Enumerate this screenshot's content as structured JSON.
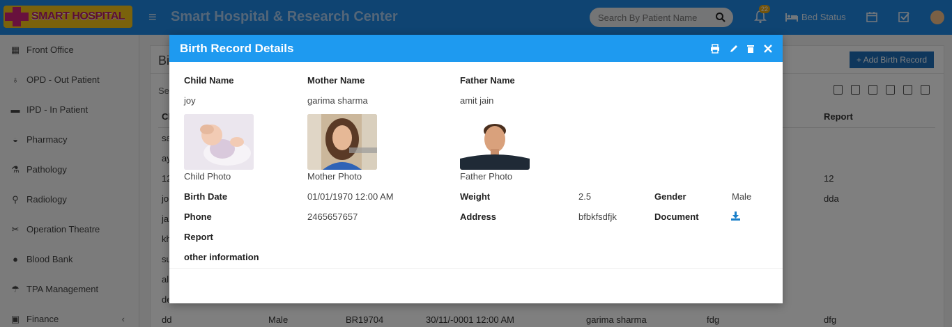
{
  "header": {
    "logo_text": "SMART HOSPITAL",
    "title": "Smart Hospital & Research Center",
    "search_placeholder": "Search By Patient Name",
    "notification_count": "22",
    "bed_status_label": "Bed Status"
  },
  "sidebar": {
    "items": [
      {
        "label": "Front Office",
        "icon": "building-icon"
      },
      {
        "label": "OPD - Out Patient",
        "icon": "stethoscope-icon"
      },
      {
        "label": "IPD - In Patient",
        "icon": "bed-icon"
      },
      {
        "label": "Pharmacy",
        "icon": "mortar-pestle-icon"
      },
      {
        "label": "Pathology",
        "icon": "flask-icon"
      },
      {
        "label": "Radiology",
        "icon": "microscope-icon"
      },
      {
        "label": "Operation Theatre",
        "icon": "scissors-icon"
      },
      {
        "label": "Blood Bank",
        "icon": "blood-drop-icon"
      },
      {
        "label": "TPA Management",
        "icon": "umbrella-icon"
      },
      {
        "label": "Finance",
        "icon": "money-icon"
      }
    ],
    "finance_chevron": "‹"
  },
  "background_page": {
    "title": "Bi",
    "add_button": "+ Add Birth Record",
    "search_label": "Sea",
    "col_first": "Ch",
    "col_report": "Report",
    "rows": [
      {
        "name": "sa",
        "report": ""
      },
      {
        "name": "ay",
        "report": ""
      },
      {
        "name": "12",
        "report": "12"
      },
      {
        "name": "jo",
        "report": "dda"
      },
      {
        "name": "ja",
        "report": ""
      },
      {
        "name": "kh",
        "report": ""
      },
      {
        "name": "su",
        "report": ""
      },
      {
        "name": "al",
        "report": ""
      },
      {
        "name": "de",
        "report": ""
      }
    ],
    "last_row": {
      "name": "dd",
      "gender": "Male",
      "ref": "BR19704",
      "date": "30/11/-0001 12:00 AM",
      "mother": "garima sharma",
      "field": "fdg",
      "report": "dfg"
    }
  },
  "modal": {
    "title": "Birth Record Details",
    "child_name_label": "Child Name",
    "child_name": "joy",
    "mother_name_label": "Mother Name",
    "mother_name": "garima sharma",
    "father_name_label": "Father Name",
    "father_name": "amit jain",
    "child_photo_label": "Child Photo",
    "mother_photo_label": "Mother Photo",
    "father_photo_label": "Father Photo",
    "birth_date_label": "Birth Date",
    "birth_date": "01/01/1970 12:00 AM",
    "weight_label": "Weight",
    "weight": "2.5",
    "gender_label": "Gender",
    "gender": "Male",
    "phone_label": "Phone",
    "phone": "2465657657",
    "address_label": "Address",
    "address": "bfbkfsdfjk",
    "document_label": "Document",
    "report_label": "Report",
    "other_info_label": "other information"
  },
  "colors": {
    "topbar": "#1e88e5",
    "modal_header": "#1e9af0",
    "download_icon": "#1a7fc9"
  }
}
